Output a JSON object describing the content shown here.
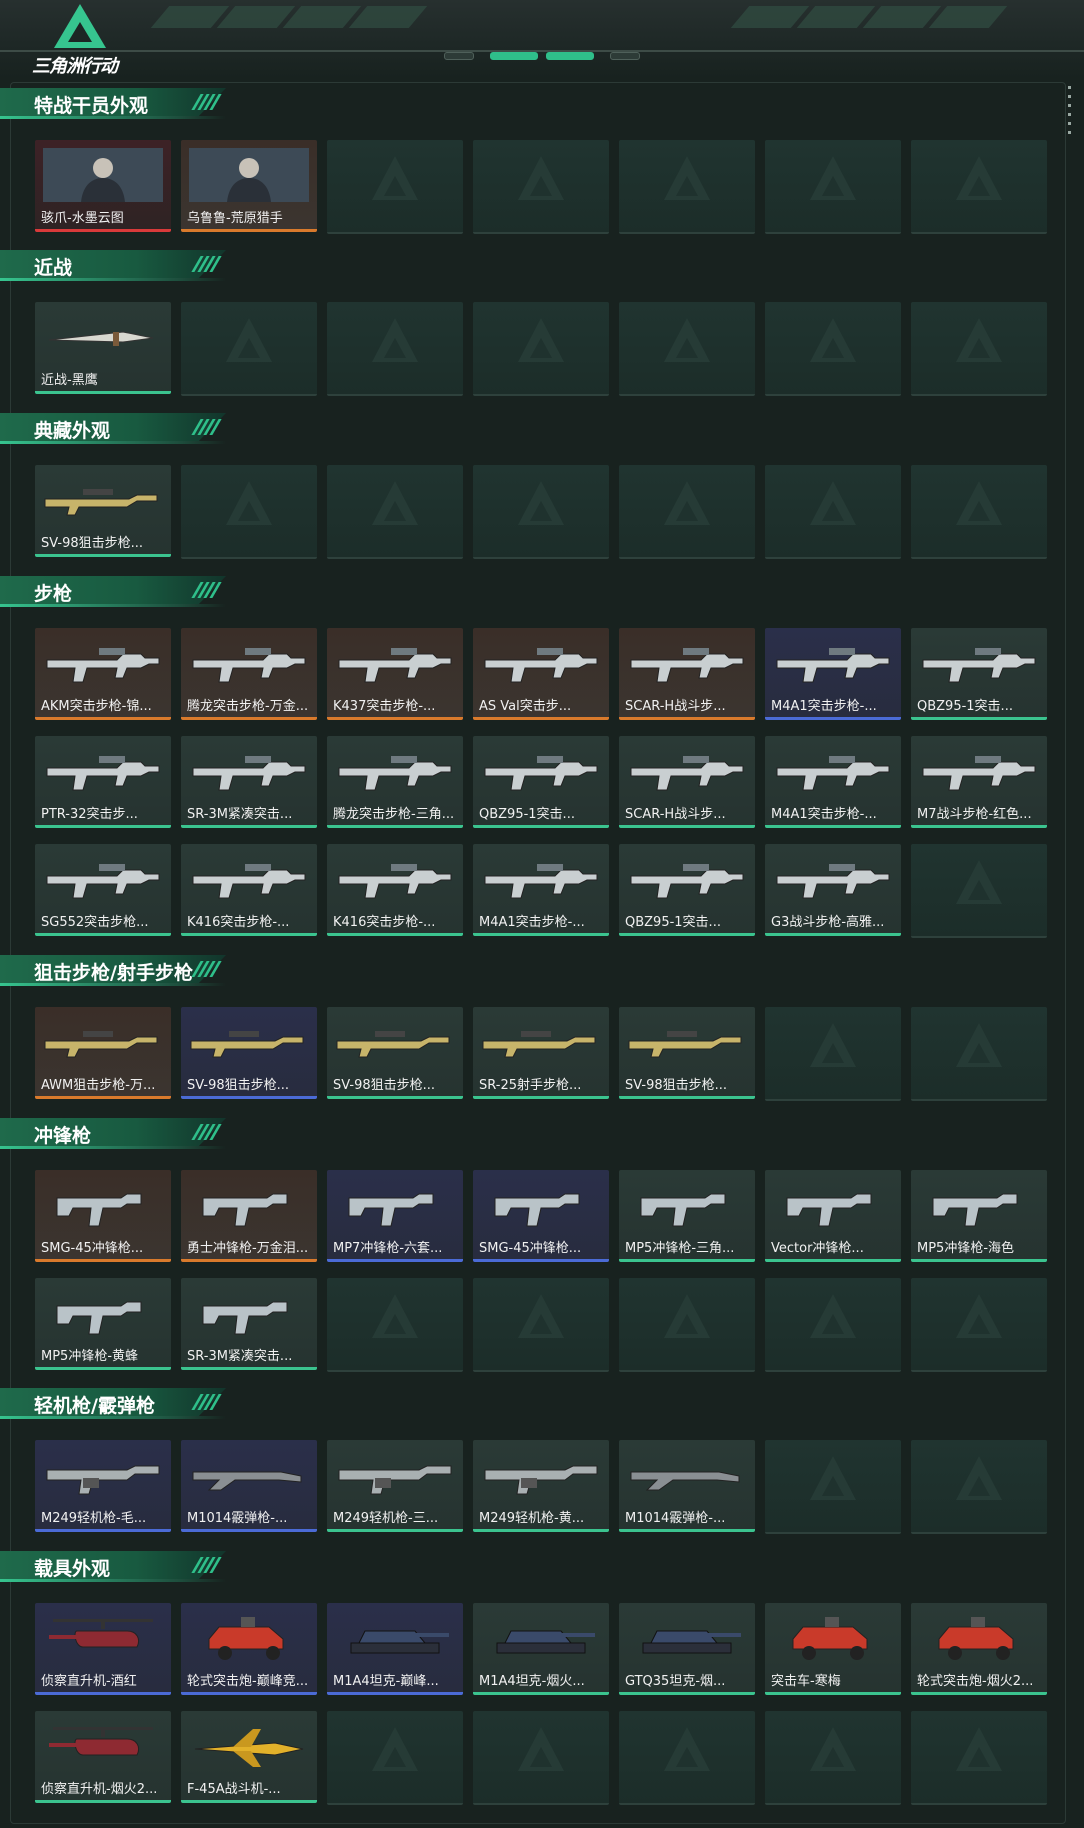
{
  "app": {
    "title": "三角洲行动"
  },
  "colors": {
    "orange": "#d97a2c",
    "blue": "#4b6bd6",
    "red": "#d83a3a",
    "green": "#3bc48f",
    "accent": "#36c58f"
  },
  "sections": [
    {
      "title": "特战干员外观",
      "items": [
        {
          "label": "骇爪-水墨云图",
          "rarity": "red",
          "icon": "operator-portrait-icon"
        },
        {
          "label": "乌鲁鲁-荒原猎手",
          "rarity": "orange",
          "icon": "operator-portrait-icon"
        }
      ]
    },
    {
      "title": "近战",
      "items": [
        {
          "label": "近战-黑鹰",
          "rarity": "green",
          "icon": "knife-icon"
        }
      ]
    },
    {
      "title": "典藏外观",
      "items": [
        {
          "label": "SV-98狙击步枪...",
          "rarity": "green",
          "icon": "sniper-rifle-icon"
        }
      ]
    },
    {
      "title": "步枪",
      "items": [
        {
          "label": "AKM突击步枪-锦...",
          "rarity": "orange",
          "icon": "rifle-icon"
        },
        {
          "label": "腾龙突击步枪-万金...",
          "rarity": "orange",
          "icon": "rifle-icon"
        },
        {
          "label": "K437突击步枪-...",
          "rarity": "orange",
          "icon": "rifle-icon"
        },
        {
          "label": "AS Val突击步...",
          "rarity": "orange",
          "icon": "rifle-icon"
        },
        {
          "label": "SCAR-H战斗步...",
          "rarity": "orange",
          "icon": "rifle-icon"
        },
        {
          "label": "M4A1突击步枪-...",
          "rarity": "blue",
          "icon": "rifle-icon"
        },
        {
          "label": "QBZ95-1突击...",
          "rarity": "green",
          "icon": "rifle-icon"
        },
        {
          "label": "PTR-32突击步...",
          "rarity": "green",
          "icon": "rifle-icon"
        },
        {
          "label": "SR-3M紧凑突击...",
          "rarity": "green",
          "icon": "rifle-icon"
        },
        {
          "label": "腾龙突击步枪-三角...",
          "rarity": "green",
          "icon": "rifle-icon"
        },
        {
          "label": "QBZ95-1突击...",
          "rarity": "green",
          "icon": "rifle-icon"
        },
        {
          "label": "SCAR-H战斗步...",
          "rarity": "green",
          "icon": "rifle-icon"
        },
        {
          "label": "M4A1突击步枪-...",
          "rarity": "green",
          "icon": "rifle-icon"
        },
        {
          "label": "M7战斗步枪-红色...",
          "rarity": "green",
          "icon": "rifle-icon"
        },
        {
          "label": "SG552突击步枪...",
          "rarity": "green",
          "icon": "rifle-icon"
        },
        {
          "label": "K416突击步枪-...",
          "rarity": "green",
          "icon": "rifle-icon"
        },
        {
          "label": "K416突击步枪-...",
          "rarity": "green",
          "icon": "rifle-icon"
        },
        {
          "label": "M4A1突击步枪-...",
          "rarity": "green",
          "icon": "rifle-icon"
        },
        {
          "label": "QBZ95-1突击...",
          "rarity": "green",
          "icon": "rifle-icon"
        },
        {
          "label": "G3战斗步枪-高雅...",
          "rarity": "green",
          "icon": "rifle-icon"
        }
      ]
    },
    {
      "title": "狙击步枪/射手步枪",
      "items": [
        {
          "label": "AWM狙击步枪-万...",
          "rarity": "orange",
          "icon": "sniper-rifle-icon"
        },
        {
          "label": "SV-98狙击步枪...",
          "rarity": "blue",
          "icon": "sniper-rifle-icon"
        },
        {
          "label": "SV-98狙击步枪...",
          "rarity": "green",
          "icon": "sniper-rifle-icon"
        },
        {
          "label": "SR-25射手步枪...",
          "rarity": "green",
          "icon": "sniper-rifle-icon"
        },
        {
          "label": "SV-98狙击步枪...",
          "rarity": "green",
          "icon": "sniper-rifle-icon"
        }
      ]
    },
    {
      "title": "冲锋枪",
      "items": [
        {
          "label": "SMG-45冲锋枪...",
          "rarity": "orange",
          "icon": "smg-icon"
        },
        {
          "label": "勇士冲锋枪-万金泪...",
          "rarity": "orange",
          "icon": "smg-icon"
        },
        {
          "label": "MP7冲锋枪-六套...",
          "rarity": "blue",
          "icon": "smg-icon"
        },
        {
          "label": "SMG-45冲锋枪...",
          "rarity": "blue",
          "icon": "smg-icon"
        },
        {
          "label": "MP5冲锋枪-三角...",
          "rarity": "green",
          "icon": "smg-icon"
        },
        {
          "label": "Vector冲锋枪...",
          "rarity": "green",
          "icon": "smg-icon"
        },
        {
          "label": "MP5冲锋枪-海色",
          "rarity": "green",
          "icon": "smg-icon"
        },
        {
          "label": "MP5冲锋枪-黄蜂",
          "rarity": "green",
          "icon": "smg-icon"
        },
        {
          "label": "SR-3M紧凑突击...",
          "rarity": "green",
          "icon": "smg-icon"
        }
      ]
    },
    {
      "title": "轻机枪/霰弹枪",
      "items": [
        {
          "label": "M249轻机枪-毛...",
          "rarity": "blue",
          "icon": "lmg-icon"
        },
        {
          "label": "M1014霰弹枪-...",
          "rarity": "blue",
          "icon": "shotgun-icon"
        },
        {
          "label": "M249轻机枪-三...",
          "rarity": "green",
          "icon": "lmg-icon"
        },
        {
          "label": "M249轻机枪-黄...",
          "rarity": "green",
          "icon": "lmg-icon"
        },
        {
          "label": "M1014霰弹枪-...",
          "rarity": "green",
          "icon": "shotgun-icon"
        }
      ]
    },
    {
      "title": "载具外观",
      "items": [
        {
          "label": "侦察直升机-酒红",
          "rarity": "blue",
          "icon": "helicopter-icon"
        },
        {
          "label": "轮式突击炮-巅峰竞...",
          "rarity": "blue",
          "icon": "armored-car-icon"
        },
        {
          "label": "M1A4坦克-巅峰...",
          "rarity": "blue",
          "icon": "tank-icon"
        },
        {
          "label": "M1A4坦克-烟火...",
          "rarity": "green",
          "icon": "tank-icon"
        },
        {
          "label": "GTQ35坦克-烟...",
          "rarity": "green",
          "icon": "tank-icon"
        },
        {
          "label": "突击车-寒梅",
          "rarity": "green",
          "icon": "armored-car-icon"
        },
        {
          "label": "轮式突击炮-烟火2...",
          "rarity": "green",
          "icon": "armored-car-icon"
        },
        {
          "label": "侦察直升机-烟火2...",
          "rarity": "green",
          "icon": "helicopter-icon"
        },
        {
          "label": "F-45A战斗机-...",
          "rarity": "green",
          "icon": "jet-icon"
        }
      ]
    }
  ]
}
